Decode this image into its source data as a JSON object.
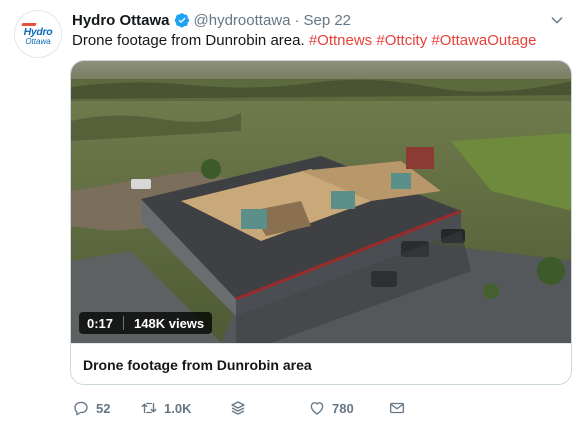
{
  "account": {
    "name": "Hydro Ottawa",
    "handle": "@hydroottawa",
    "separator": "·",
    "date": "Sep 22",
    "avatar_logo_top": "Hydro",
    "avatar_logo_bottom": "Ottawa"
  },
  "tweet": {
    "text": "Drone footage from Dunrobin area.",
    "hashtags": [
      "#Ottnews",
      "#Ottcity",
      "#OttawaOutage"
    ]
  },
  "video": {
    "duration": "0:17",
    "views": "148K views",
    "title": "Drone footage from Dunrobin area"
  },
  "actions": {
    "replies": "52",
    "retweets": "1.0K",
    "likes": "780"
  },
  "icons": {
    "verified": "verified-badge-icon",
    "menu": "chevron-down-icon",
    "reply": "reply-icon",
    "retweet": "retweet-icon",
    "stack": "stack-icon",
    "like": "heart-icon",
    "dm": "envelope-icon"
  },
  "colors": {
    "hashtag": "#e8403a",
    "verified": "#1da1f2",
    "muted": "#657786"
  }
}
